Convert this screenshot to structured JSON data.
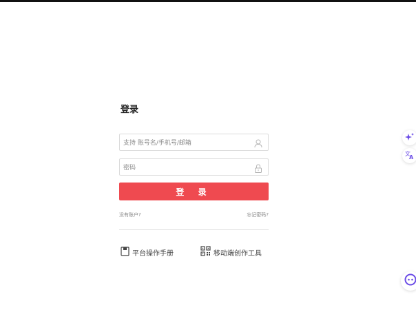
{
  "login": {
    "title": "登录",
    "username_placeholder": "支持 账号名/手机号/邮箱",
    "username_value": "",
    "password_placeholder": "密码",
    "password_value": "",
    "submit_label": "登 录",
    "no_account_label": "没有账户?",
    "forgot_password_label": "忘记密码?"
  },
  "tools": {
    "manual_label": "平台操作手册",
    "mobile_label": "移动端创作工具"
  },
  "icons": {
    "username": "user-icon",
    "password": "lock-icon",
    "manual": "book-icon",
    "mobile": "qrcode-icon",
    "ai": "sparkle-icon",
    "translate": "translate-icon",
    "chat": "chat-bot-icon"
  },
  "colors": {
    "primary": "#ef4a50",
    "accent_side": "#6b4ce6"
  }
}
